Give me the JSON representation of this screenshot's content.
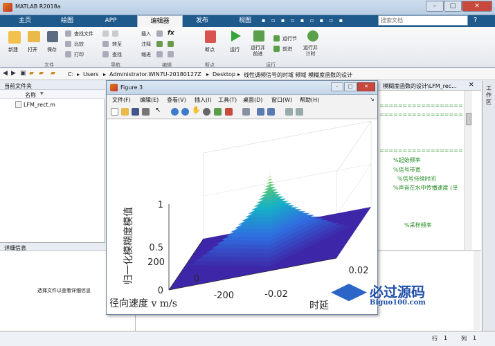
{
  "window": {
    "title": "MATLAB R2018a",
    "minimize": "–",
    "maximize": "□",
    "close": "✕"
  },
  "tabs": [
    {
      "label": "主页"
    },
    {
      "label": "绘图"
    },
    {
      "label": "APP"
    },
    {
      "label": "编辑器"
    },
    {
      "label": "发布"
    },
    {
      "label": "视图"
    }
  ],
  "search": {
    "placeholder": "搜索文档"
  },
  "ribbon": {
    "new": "新建",
    "open": "打开",
    "save": "保存",
    "find_files": "查找文件",
    "compare": "比较",
    "print": "打印",
    "goto": "转至",
    "find": "查找",
    "insert": "插入",
    "comment": "注释",
    "indent": "缩进",
    "fx": "fx",
    "breakpoint": "断点",
    "run": "运行",
    "run_advance": "运行并\n前进",
    "run_section": "运行节",
    "advance": "前进",
    "run_time": "运行并\n计时",
    "grp_file": "文件",
    "grp_nav": "导航",
    "grp_edit": "编辑",
    "grp_bp": "断点",
    "grp_run": "运行"
  },
  "path": [
    "C:",
    "Users",
    "Administrator.WIN7U-20180127Z",
    "Desktop",
    "线性调频信号的时域 频域 模糊度函数的设计"
  ],
  "left": {
    "header": "当前文件夹",
    "col_name": "名称",
    "files": [
      {
        "name": "LFM_rect.m"
      }
    ],
    "detail_header": "详细信息",
    "detail_text": "选择文件以查看详细信息"
  },
  "editor": {
    "tab": "模糊度函数的设计\\LFM_rec...",
    "lines": [
      "%起始频率",
      "%信号带宽",
      "%信号持续时间",
      "%声音在水中传播速度 (单",
      "%采样频率"
    ]
  },
  "workspace": {
    "label": "工作区"
  },
  "status": {
    "row_label": "行",
    "row": "1",
    "col_label": "列",
    "col": "1"
  },
  "figure": {
    "title": "Figure 3",
    "menus": [
      "文件(F)",
      "编辑(E)",
      "查看(V)",
      "插入(I)",
      "工具(T)",
      "桌面(D)",
      "窗口(W)",
      "帮助(H)"
    ]
  },
  "chart_data": {
    "type": "surface",
    "zlabel": "归一化模糊度模值",
    "xlabel": "时延",
    "ylabel": "径向速度 v   m/s",
    "z_ticks": [
      "0",
      "0.5",
      "1"
    ],
    "y_ticks": [
      "200",
      "0",
      "-200"
    ],
    "x_ticks": [
      "-0.02",
      "0.02"
    ],
    "zlim": [
      0,
      1
    ],
    "ylim": [
      -250,
      250
    ],
    "xlim": [
      -0.03,
      0.03
    ],
    "peak": 1,
    "colormap": [
      "#3e26a8",
      "#2f6ee0",
      "#16b0c7",
      "#60c96c",
      "#f6d62a"
    ]
  },
  "watermark": {
    "text": "必过源码",
    "url": "Biguo100.com"
  }
}
